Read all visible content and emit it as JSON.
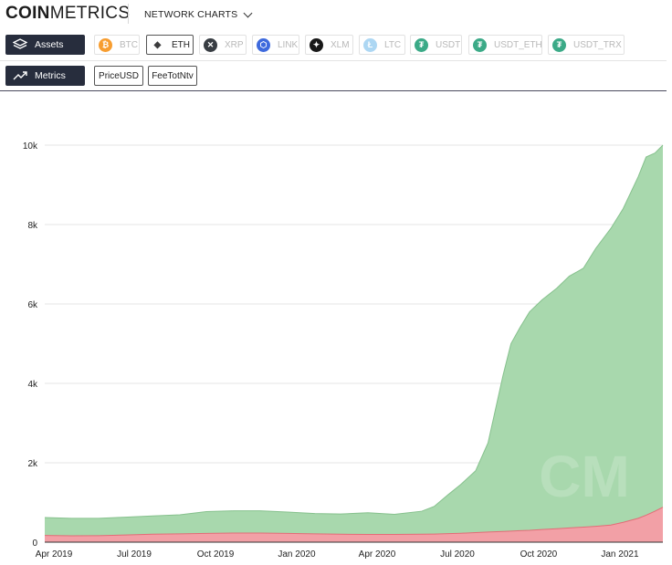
{
  "header": {
    "logo_bold": "COIN",
    "logo_light": "METRICS",
    "nav_title": "NETWORK CHARTS"
  },
  "toolbar": {
    "assets_label": "Assets",
    "metrics_label": "Metrics",
    "assets": [
      {
        "label": "BTC",
        "active": false,
        "color": "#f7931a",
        "glyph": "₿"
      },
      {
        "label": "ETH",
        "active": true,
        "color": "#ffffff",
        "glyph": "◆"
      },
      {
        "label": "XRP",
        "active": false,
        "color": "#23292f",
        "glyph": "✕"
      },
      {
        "label": "LINK",
        "active": false,
        "color": "#2a5ada",
        "glyph": "⬡"
      },
      {
        "label": "XLM",
        "active": false,
        "color": "#000000",
        "glyph": "✦"
      },
      {
        "label": "LTC",
        "active": false,
        "color": "#a5d3f2",
        "glyph": "Ł"
      },
      {
        "label": "USDT",
        "active": false,
        "color": "#26a17b",
        "glyph": "₮"
      },
      {
        "label": "USDT_ETH",
        "active": false,
        "color": "#26a17b",
        "glyph": "₮"
      },
      {
        "label": "USDT_TRX",
        "active": false,
        "color": "#26a17b",
        "glyph": "₮"
      }
    ],
    "metrics": [
      {
        "label": "PriceUSD"
      },
      {
        "label": "FeeTotNtv"
      }
    ]
  },
  "chart_data": {
    "type": "area",
    "x": [
      "2019-04-01",
      "2019-05-01",
      "2019-06-01",
      "2019-07-01",
      "2019-08-01",
      "2019-09-01",
      "2019-10-01",
      "2019-11-01",
      "2019-12-01",
      "2020-01-01",
      "2020-02-01",
      "2020-03-01",
      "2020-04-01",
      "2020-05-01",
      "2020-06-01",
      "2020-06-15",
      "2020-07-01",
      "2020-07-15",
      "2020-08-01",
      "2020-08-15",
      "2020-09-01",
      "2020-09-10",
      "2020-09-20",
      "2020-10-01",
      "2020-10-15",
      "2020-11-01",
      "2020-11-15",
      "2020-12-01",
      "2020-12-15",
      "2021-01-01",
      "2021-01-15",
      "2021-02-01",
      "2021-02-10",
      "2021-02-20",
      "2021-03-01"
    ],
    "series": [
      {
        "color": "#a8d8ad",
        "values": [
          620,
          600,
          600,
          630,
          660,
          690,
          770,
          790,
          790,
          760,
          720,
          710,
          740,
          700,
          780,
          900,
          1200,
          1450,
          1800,
          2500,
          4200,
          5000,
          5400,
          5800,
          6100,
          6400,
          6700,
          6900,
          7400,
          7900,
          8400,
          9200,
          9700,
          9800,
          10000
        ]
      },
      {
        "color": "#f2a0a6",
        "values": [
          170,
          160,
          165,
          180,
          200,
          210,
          220,
          230,
          230,
          220,
          210,
          200,
          195,
          195,
          200,
          205,
          215,
          225,
          240,
          255,
          270,
          280,
          290,
          300,
          320,
          340,
          360,
          380,
          400,
          430,
          500,
          600,
          680,
          780,
          880
        ]
      }
    ],
    "x_ticks": [
      "Apr 2019",
      "Jul 2019",
      "Oct 2019",
      "Jan 2020",
      "Apr 2020",
      "Jul 2020",
      "Oct 2020",
      "Jan 2021"
    ],
    "y_ticks": [
      "0",
      "2k",
      "4k",
      "6k",
      "8k",
      "10k"
    ],
    "ylim": [
      0,
      10000
    ],
    "grid": true,
    "watermark": "CM"
  }
}
